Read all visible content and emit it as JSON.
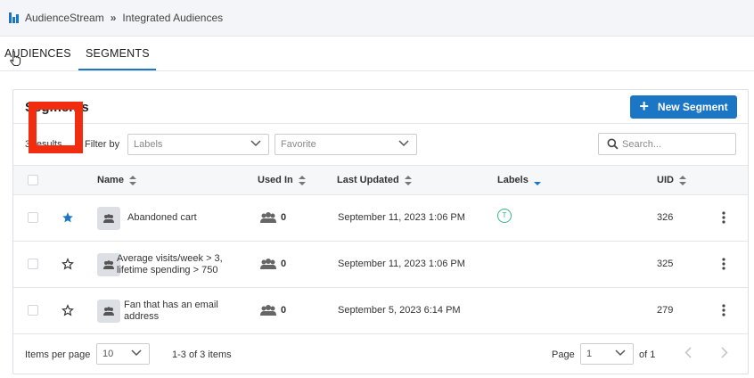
{
  "breadcrumb": {
    "app": "AudienceStream",
    "separator": "»",
    "page": "Integrated Audiences"
  },
  "tabs": [
    {
      "label": "AUDIENCES"
    },
    {
      "label": "SEGMENTS"
    }
  ],
  "panel": {
    "title": "Segments",
    "new_button_label": "New Segment",
    "results_count": "3 results",
    "filter_by_label": "Filter by",
    "labels_filter": "Labels",
    "favorite_filter": "Favorite",
    "search_placeholder": "Search..."
  },
  "columns": {
    "name": "Name",
    "used_in": "Used In",
    "last_updated": "Last Updated",
    "labels": "Labels",
    "uid": "UID"
  },
  "rows": [
    {
      "favorite": true,
      "name": "Abandoned cart",
      "used_in": "0",
      "last_updated": "September 11, 2023 1:06 PM",
      "label_badge": "T",
      "uid": "326"
    },
    {
      "favorite": false,
      "name_line1": "Average visits/week > 3,",
      "name_line2": "lifetime spending > 750",
      "used_in": "0",
      "last_updated": "September 11, 2023 1:06 PM",
      "label_badge": "",
      "uid": "325"
    },
    {
      "favorite": false,
      "name_line1": "Fan that has an email",
      "name_line2": "address",
      "used_in": "0",
      "last_updated": "September 5, 2023 6:14 PM",
      "label_badge": "",
      "uid": "279"
    }
  ],
  "footer": {
    "items_per_page_label": "Items per page",
    "items_per_page_value": "10",
    "range_text": "1-3 of 3 items",
    "page_label": "Page",
    "page_value": "1",
    "page_total": "of 1"
  },
  "colors": {
    "accent": "#1b76c6",
    "highlight": "#f22d0f",
    "label_badge": "#36b38a"
  }
}
